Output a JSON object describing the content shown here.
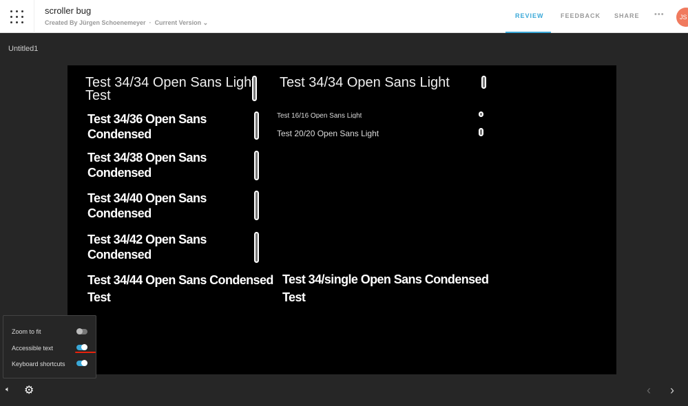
{
  "header": {
    "title": "scroller bug",
    "created_by": "Created By Jürgen Schoenemeyer",
    "separator": "·",
    "version": "Current Version ⌄",
    "tabs": [
      "REVIEW",
      "FEEDBACK",
      "SHARE"
    ],
    "more": "•••",
    "avatar": "JS"
  },
  "page_name": "Untitled1",
  "canvas": {
    "left": [
      {
        "l1": "Test 34/34 Open Sans Light",
        "l2": "Test"
      },
      {
        "l1": "Test 34/36 Open Sans",
        "l2": "Condensed"
      },
      {
        "l1": "Test 34/38 Open Sans",
        "l2": "Condensed"
      },
      {
        "l1": "Test 34/40 Open Sans",
        "l2": "Condensed"
      },
      {
        "l1": "Test 34/42 Open Sans",
        "l2": "Condensed"
      },
      {
        "l1": "Test 34/44 Open Sans Condensed",
        "l2": "Test"
      }
    ],
    "right": [
      {
        "l1": "Test 34/34 Open Sans Light"
      },
      {
        "l1": "Test 16/16 Open Sans Light"
      },
      {
        "l1": "Test  20/20 Open Sans Light"
      },
      {
        "l1": "Test 34/single Open Sans Condensed",
        "l2": "Test"
      }
    ]
  },
  "settings": {
    "options": [
      {
        "label": "Zoom to fit",
        "on": false
      },
      {
        "label": "Accessible text",
        "on": true
      },
      {
        "label": "Keyboard shortcuts",
        "on": true
      }
    ]
  },
  "colors": {
    "accent": "#3aa8d8",
    "avatar": "#f07a5e",
    "annotation": "#e8220c"
  }
}
